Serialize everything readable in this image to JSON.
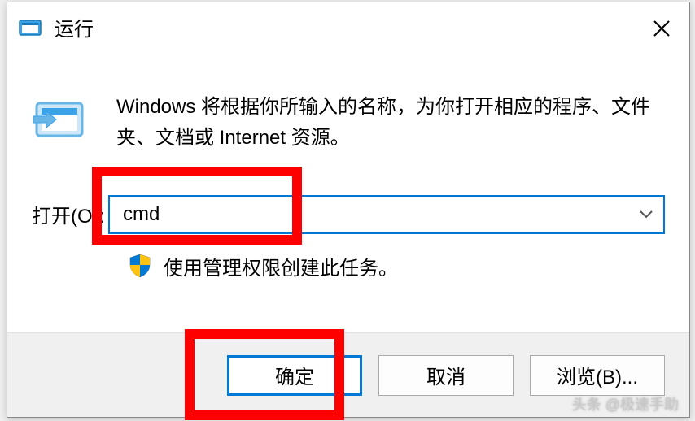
{
  "dialog": {
    "title": "运行",
    "description": "Windows 将根据你所输入的名称，为你打开相应的程序、文件夹、文档或 Internet 资源。",
    "open_label": "打开(O):",
    "input_value": "cmd",
    "admin_text": "使用管理权限创建此任务。",
    "buttons": {
      "ok": "确定",
      "cancel": "取消",
      "browse": "浏览(B)..."
    }
  },
  "watermark": "头条 @极速手助"
}
